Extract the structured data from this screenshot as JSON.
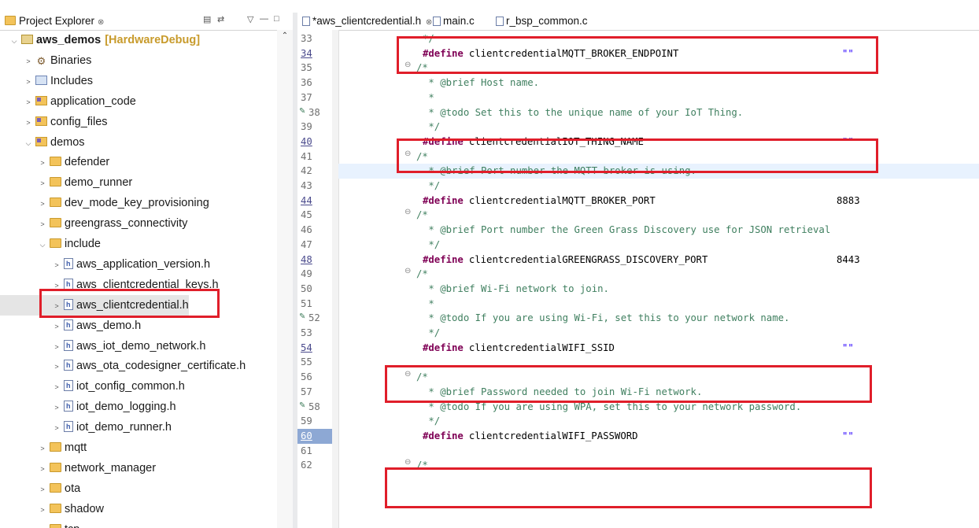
{
  "explorer": {
    "tab_title": "Project Explorer",
    "tab_close": "⊗",
    "tree": [
      {
        "label": "aws_demos",
        "suffix": "[HardwareDebug]",
        "arrow": "⌵",
        "icon": "project-icon"
      },
      {
        "label": "Binaries",
        "arrow": ">",
        "icon": "binaries-icon"
      },
      {
        "label": "Includes",
        "arrow": ">",
        "icon": "includes-icon"
      },
      {
        "label": "application_code",
        "arrow": ">",
        "icon": "source-folder-icon"
      },
      {
        "label": "config_files",
        "arrow": ">",
        "icon": "source-folder-icon"
      },
      {
        "label": "demos",
        "arrow": "⌵",
        "icon": "source-folder-icon"
      },
      {
        "label": "defender",
        "arrow": ">",
        "icon": "folder-icon"
      },
      {
        "label": "demo_runner",
        "arrow": ">",
        "icon": "folder-icon"
      },
      {
        "label": "dev_mode_key_provisioning",
        "arrow": ">",
        "icon": "folder-icon"
      },
      {
        "label": "greengrass_connectivity",
        "arrow": ">",
        "icon": "folder-icon"
      },
      {
        "label": "include",
        "arrow": "⌵",
        "icon": "folder-icon"
      },
      {
        "label": "aws_application_version.h",
        "arrow": ">",
        "icon": "header-file-icon"
      },
      {
        "label": "aws_clientcredential_keys.h",
        "arrow": ">",
        "icon": "header-file-icon"
      },
      {
        "label": "aws_clientcredential.h",
        "arrow": ">",
        "icon": "header-file-icon"
      },
      {
        "label": "aws_demo.h",
        "arrow": ">",
        "icon": "header-file-icon"
      },
      {
        "label": "aws_iot_demo_network.h",
        "arrow": ">",
        "icon": "header-file-icon"
      },
      {
        "label": "aws_ota_codesigner_certificate.h",
        "arrow": ">",
        "icon": "header-file-icon"
      },
      {
        "label": "iot_config_common.h",
        "arrow": ">",
        "icon": "header-file-icon"
      },
      {
        "label": "iot_demo_logging.h",
        "arrow": ">",
        "icon": "header-file-icon"
      },
      {
        "label": "iot_demo_runner.h",
        "arrow": ">",
        "icon": "header-file-icon"
      },
      {
        "label": "mqtt",
        "arrow": ">",
        "icon": "folder-icon"
      },
      {
        "label": "network_manager",
        "arrow": ">",
        "icon": "folder-icon"
      },
      {
        "label": "ota",
        "arrow": ">",
        "icon": "folder-icon"
      },
      {
        "label": "shadow",
        "arrow": ">",
        "icon": "folder-icon"
      },
      {
        "label": "tcp",
        "arrow": ">",
        "icon": "folder-icon"
      }
    ],
    "selected": "aws_clientcredential.h"
  },
  "editor": {
    "tabs": [
      {
        "label": "*aws_clientcredential.h",
        "close": "⊗",
        "active": true
      },
      {
        "label": "main.c"
      },
      {
        "label": "r_bsp_common.c"
      }
    ],
    "lines": [
      {
        "n": "33",
        "text": "*/"
      },
      {
        "n": "34",
        "kw": "#define",
        "name": "clientcredentialMQTT_BROKER_ENDPOINT",
        "val": "\"\""
      },
      {
        "n": "35",
        "text": "/*"
      },
      {
        "n": "36",
        "text": " * @brief Host name."
      },
      {
        "n": "37",
        "text": " *"
      },
      {
        "n": "38",
        "text": " * @todo Set this to the unique name of your IoT Thing."
      },
      {
        "n": "39",
        "text": " */"
      },
      {
        "n": "40",
        "kw": "#define",
        "name": "clientcredentialIOT_THING_NAME",
        "val": "\"\""
      },
      {
        "n": "41",
        "text": "/*"
      },
      {
        "n": "42",
        "text": " * @brief Port number the MQTT broker is using."
      },
      {
        "n": "43",
        "text": " */"
      },
      {
        "n": "44",
        "kw": "#define",
        "name": "clientcredentialMQTT_BROKER_PORT",
        "val": "8883"
      },
      {
        "n": "45",
        "text": "/*"
      },
      {
        "n": "46",
        "text": " * @brief Port number the Green Grass Discovery use for JSON retrieval"
      },
      {
        "n": "47",
        "text": " */"
      },
      {
        "n": "48",
        "kw": "#define",
        "name": "clientcredentialGREENGRASS_DISCOVERY_PORT",
        "val": "8443"
      },
      {
        "n": "49",
        "text": "/*"
      },
      {
        "n": "50",
        "text": " * @brief Wi-Fi network to join."
      },
      {
        "n": "51",
        "text": " *"
      },
      {
        "n": "52",
        "text": " * @todo If you are using Wi-Fi, set this to your network name."
      },
      {
        "n": "53",
        "text": " */"
      },
      {
        "n": "54",
        "kw": "#define",
        "name": "clientcredentialWIFI_SSID",
        "val": "\"\""
      },
      {
        "n": "55",
        "text": ""
      },
      {
        "n": "56",
        "text": "/*"
      },
      {
        "n": "57",
        "text": " * @brief Password needed to join Wi-Fi network."
      },
      {
        "n": "58",
        "text": " * @todo If you are using WPA, set this to your network password."
      },
      {
        "n": "59",
        "text": " */"
      },
      {
        "n": "60",
        "kw": "#define",
        "name": "clientcredentialWIFI_PASSWORD",
        "val": "\"\""
      },
      {
        "n": "61",
        "text": ""
      },
      {
        "n": "62",
        "text": "/*"
      }
    ]
  },
  "colors": {
    "highlight_box": "#e01e2a",
    "keyword": "#7f0055",
    "comment": "#3f7f5f",
    "string": "#2a00ff"
  }
}
